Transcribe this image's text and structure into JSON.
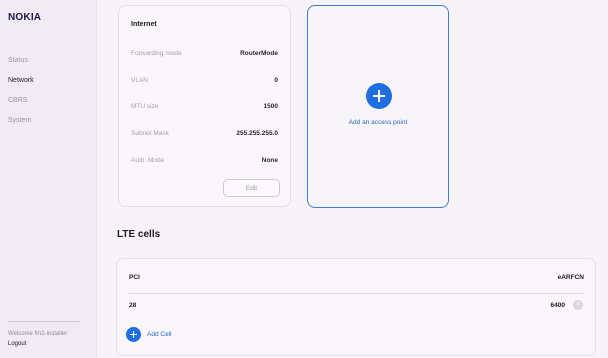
{
  "sidebar": {
    "logo": "NOKIA",
    "items": [
      {
        "label": "Status"
      },
      {
        "label": "Network"
      },
      {
        "label": "CBRS"
      },
      {
        "label": "System"
      }
    ],
    "welcome": "Welcome fm2-installer",
    "logout": "Logout"
  },
  "internet": {
    "title": "Internet",
    "rows": [
      {
        "label": "Forwarding mode",
        "value": "RouterMode"
      },
      {
        "label": "VLAN",
        "value": "0"
      },
      {
        "label": "MTU size",
        "value": "1500"
      },
      {
        "label": "Subnet Mask",
        "value": "255.255.255.0"
      },
      {
        "label": "Auth. Mode",
        "value": "None"
      }
    ],
    "edit_label": "Edit"
  },
  "access_point": {
    "add_label": "Add an access point"
  },
  "lte": {
    "title": "LTE cells",
    "columns": {
      "pci": "PCI",
      "earfcn": "eARFCN"
    },
    "rows": [
      {
        "pci": "28",
        "earfcn": "6400"
      }
    ],
    "add_label": "Add Cell"
  },
  "colors": {
    "accent": "#1f6fe0",
    "link": "#2c64c2",
    "background": "#f7f3f9"
  }
}
